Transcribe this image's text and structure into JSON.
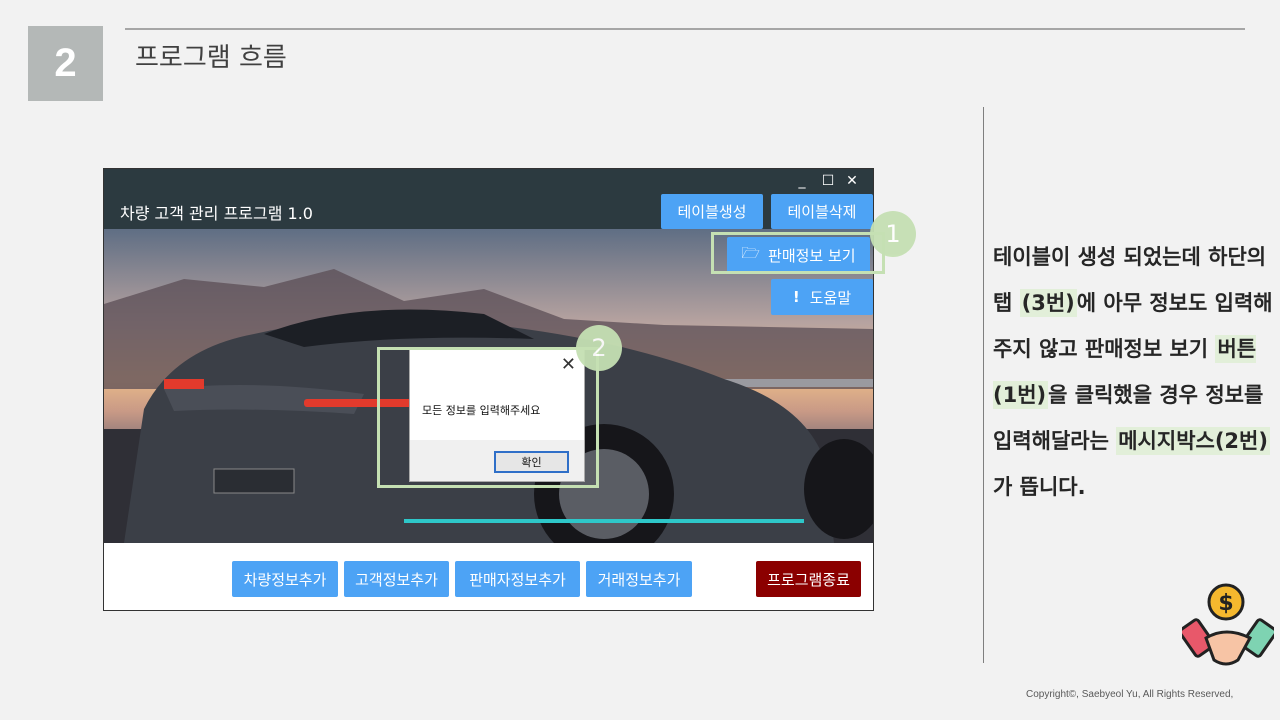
{
  "slide": {
    "number": "2",
    "title": "프로그램 흐름",
    "copyright": "Copyright©, Saebyeol Yu, All Rights Reserved,"
  },
  "window": {
    "controls": {
      "minimize": "_",
      "maximize": "☐",
      "close": "✕"
    },
    "app_title": "차량 고객 관리 프로그램 1.0",
    "header_buttons": {
      "create_table": "테이블생성",
      "delete_table": "테이블삭제"
    },
    "view_sales": "판매정보 보기",
    "help": "도움말",
    "bottom_buttons": [
      "차량정보추가",
      "고객정보추가",
      "판매자정보추가",
      "거래정보추가"
    ],
    "exit": "프로그램종료"
  },
  "dialog": {
    "message": "모든 정보를 입력해주세요",
    "ok": "확인",
    "close": "✕"
  },
  "badges": {
    "one": "1",
    "two": "2"
  },
  "description": {
    "p1": "테이블이 생성 되었는데 하단의 탭 ",
    "h1": "(3번)",
    "p2": "에 아무 정보도 입력해주지 않고 판매정보 보기 ",
    "h2": "버튼(1번)",
    "p3": "을 클릭했을 경우 정보를 입력해달라는 ",
    "h3": "메시지박스(2번)",
    "p4": "가 뜹니다."
  },
  "colors": {
    "accent_blue": "#4da3f5",
    "exit_red": "#8b0000",
    "highlight_green": "#c5e0b3"
  }
}
